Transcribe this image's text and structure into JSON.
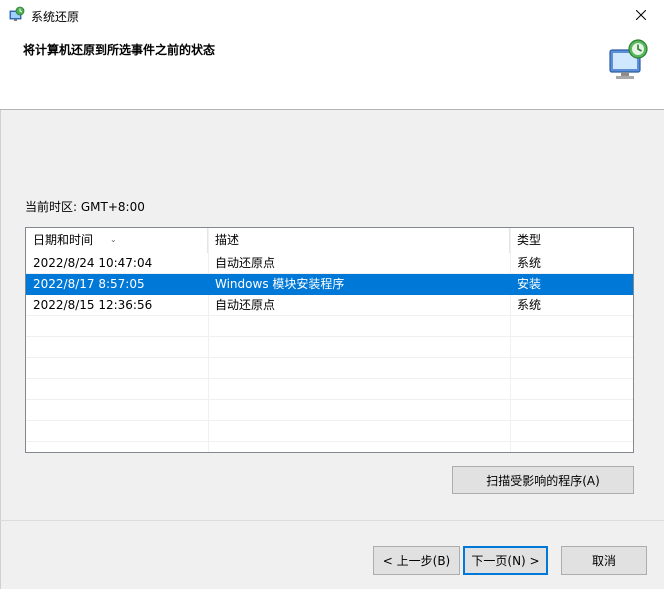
{
  "window": {
    "title": "系统还原",
    "app_icon": "system-restore-icon",
    "close_icon": "close-icon"
  },
  "header": {
    "title": "将计算机还原到所选事件之前的状态",
    "icon": "monitor-restore-icon"
  },
  "timezone_label": "当前时区: GMT+8:00",
  "table": {
    "columns": [
      "日期和时间",
      "描述",
      "类型"
    ],
    "sort_indicator": "chevron-down-icon",
    "rows": [
      {
        "date": "2022/8/24 10:47:04",
        "description": "自动还原点",
        "type": "系统",
        "selected": false
      },
      {
        "date": "2022/8/17 8:57:05",
        "description": "Windows 模块安装程序",
        "type": "安装",
        "selected": true
      },
      {
        "date": "2022/8/15 12:36:56",
        "description": "自动还原点",
        "type": "系统",
        "selected": false
      }
    ]
  },
  "buttons": {
    "scan": "扫描受影响的程序(A)",
    "back": "< 上一步(B)",
    "next": "下一页(N) >",
    "cancel": "取消"
  },
  "colors": {
    "selection": "#0078d7",
    "header_bg": "#ffffff",
    "body_bg": "#f0f0f0"
  }
}
